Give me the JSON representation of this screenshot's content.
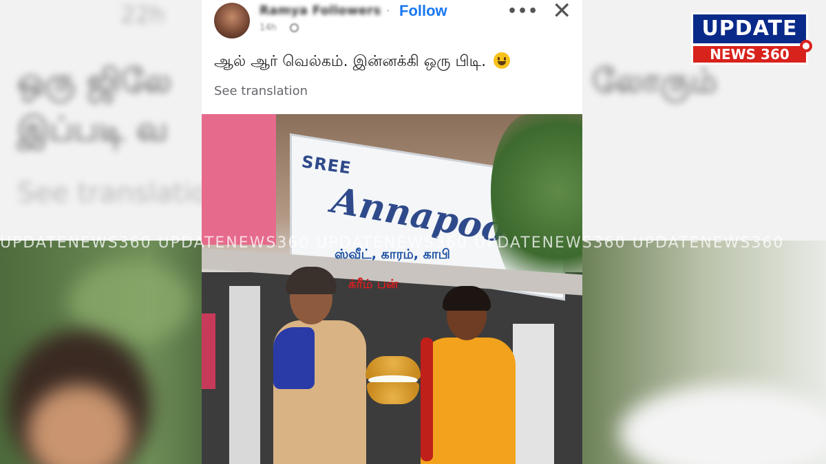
{
  "post": {
    "author_name": "Ramya Followers",
    "time": "14h",
    "follow_label": "Follow",
    "text": "ஆல் ஆர் வெல்கம். இன்னக்கி ஒரு பிடி.",
    "emoji": "smiling-face-icon",
    "see_translation": "See translation"
  },
  "background": {
    "time": "22h",
    "line1_left": "ஒரு ஜிலே",
    "line2_left": "இப்படி வ",
    "see_translation": "See translatio",
    "line1_right": "லோரும்"
  },
  "photo": {
    "sign_small": "SREE",
    "sign_big": "Annapoorna",
    "overlay_line1": "ஸ்வீட், காரம், காபி",
    "overlay_line2": "க்ரீம் பன்",
    "overlay_line1_color": "#1d4fa0",
    "overlay_line2_color": "#d12020"
  },
  "watermark": {
    "text": "UPDATENEWS360  UPDATENEWS360  UPDATENEWS360  UPDATENEWS360  UPDATENEWS360"
  },
  "logo": {
    "line1": "UPDATE",
    "line2": "NEWS 360",
    "primary_color": "#0a2a8a",
    "accent_color": "#d8221c"
  },
  "icons": {
    "more": "more-options-icon",
    "close": "close-icon",
    "globe": "globe-icon"
  }
}
